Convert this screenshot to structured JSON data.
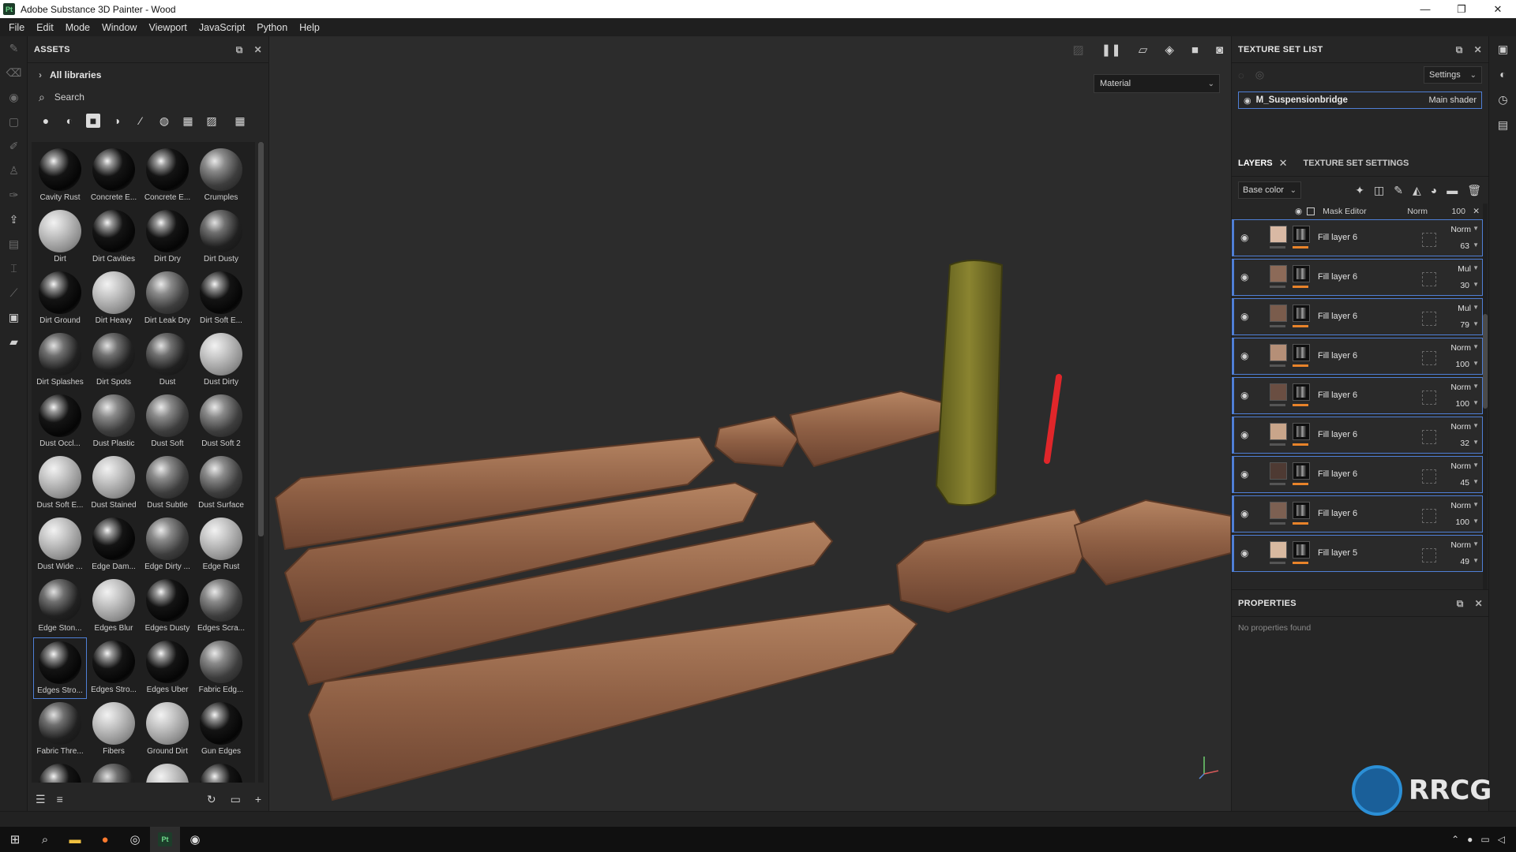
{
  "window": {
    "app_icon": "Pt",
    "title": "Adobe Substance 3D Painter - Wood",
    "minimize": "—",
    "maximize": "❐",
    "close": "✕"
  },
  "menu": [
    "File",
    "Edit",
    "Mode",
    "Window",
    "Viewport",
    "JavaScript",
    "Python",
    "Help"
  ],
  "assets": {
    "header": "ASSETS",
    "libraries": "All libraries",
    "search_placeholder": "Search",
    "items": [
      {
        "label": "Cavity Rust",
        "style": "dark"
      },
      {
        "label": "Concrete E...",
        "style": "dark"
      },
      {
        "label": "Concrete E...",
        "style": "dark"
      },
      {
        "label": "Crumples",
        "style": "mid"
      },
      {
        "label": "Dirt",
        "style": "light"
      },
      {
        "label": "Dirt Cavities",
        "style": "dark"
      },
      {
        "label": "Dirt Dry",
        "style": "dark"
      },
      {
        "label": "Dirt Dusty",
        "style": "noise"
      },
      {
        "label": "Dirt Ground",
        "style": "dark"
      },
      {
        "label": "Dirt Heavy",
        "style": "light"
      },
      {
        "label": "Dirt Leak Dry",
        "style": "mid"
      },
      {
        "label": "Dirt Soft E...",
        "style": "dark"
      },
      {
        "label": "Dirt Splashes",
        "style": "noise"
      },
      {
        "label": "Dirt Spots",
        "style": "noise"
      },
      {
        "label": "Dust",
        "style": "noise"
      },
      {
        "label": "Dust Dirty",
        "style": "light"
      },
      {
        "label": "Dust Occl...",
        "style": "dark"
      },
      {
        "label": "Dust Plastic",
        "style": "mid"
      },
      {
        "label": "Dust Soft",
        "style": "mid"
      },
      {
        "label": "Dust Soft 2",
        "style": "mid"
      },
      {
        "label": "Dust Soft E...",
        "style": "light"
      },
      {
        "label": "Dust Stained",
        "style": "light"
      },
      {
        "label": "Dust Subtle",
        "style": "mid"
      },
      {
        "label": "Dust Surface",
        "style": "mid"
      },
      {
        "label": "Dust Wide ...",
        "style": "light"
      },
      {
        "label": "Edge Dam...",
        "style": "dark"
      },
      {
        "label": "Edge Dirty ...",
        "style": "mid"
      },
      {
        "label": "Edge Rust",
        "style": "light"
      },
      {
        "label": "Edge Ston...",
        "style": "noise"
      },
      {
        "label": "Edges Blur",
        "style": "light"
      },
      {
        "label": "Edges Dusty",
        "style": "dark"
      },
      {
        "label": "Edges Scra...",
        "style": "mid"
      },
      {
        "label": "Edges Stro...",
        "style": "dark"
      },
      {
        "label": "Edges Stro...",
        "style": "dark"
      },
      {
        "label": "Edges Uber",
        "style": "dark"
      },
      {
        "label": "Fabric Edg...",
        "style": "mid"
      },
      {
        "label": "Fabric Thre...",
        "style": "noise"
      },
      {
        "label": "Fibers",
        "style": "light"
      },
      {
        "label": "Ground Dirt",
        "style": "light"
      },
      {
        "label": "Gun Edges",
        "style": "dark"
      },
      {
        "label": "",
        "style": "dark"
      },
      {
        "label": "",
        "style": "noise"
      },
      {
        "label": "",
        "style": "light"
      },
      {
        "label": "",
        "style": "dark"
      }
    ]
  },
  "viewport": {
    "mode_select": "Material"
  },
  "texture_set_list": {
    "header": "TEXTURE SET LIST",
    "settings_label": "Settings",
    "set_name": "M_Suspensionbridge",
    "shader": "Main shader"
  },
  "layers": {
    "tab_layers": "LAYERS",
    "tab_settings": "TEXTURE SET SETTINGS",
    "channel": "Base color",
    "mask_row": {
      "name": "Mask Editor",
      "blend": "Norm",
      "opacity": "100"
    },
    "rows": [
      {
        "name": "Fill layer 6",
        "blend": "Norm",
        "opacity": "63",
        "swatch": "#d9b9a4"
      },
      {
        "name": "Fill layer 6",
        "blend": "Mul",
        "opacity": "30",
        "swatch": "#8c6a58"
      },
      {
        "name": "Fill layer 6",
        "blend": "Mul",
        "opacity": "79",
        "swatch": "#7a5c4c"
      },
      {
        "name": "Fill layer 6",
        "blend": "Norm",
        "opacity": "100",
        "swatch": "#b58f77"
      },
      {
        "name": "Fill layer 6",
        "blend": "Norm",
        "opacity": "100",
        "swatch": "#6a4e42"
      },
      {
        "name": "Fill layer 6",
        "blend": "Norm",
        "opacity": "32",
        "swatch": "#c9a58a"
      },
      {
        "name": "Fill layer 6",
        "blend": "Norm",
        "opacity": "45",
        "swatch": "#4e3a33"
      },
      {
        "name": "Fill layer 6",
        "blend": "Norm",
        "opacity": "100",
        "swatch": "#7c6052"
      },
      {
        "name": "Fill layer 5",
        "blend": "Norm",
        "opacity": "49",
        "swatch": "#d8b9a0"
      }
    ]
  },
  "properties": {
    "header": "PROPERTIES",
    "empty_text": "No properties found"
  },
  "colors": {
    "selection": "#4f7fd6",
    "mask_bar": "#e8832a",
    "wood": "#8a5a3f",
    "pole": "#7a7a2a",
    "rope": "#e0262a"
  },
  "watermark": {
    "text": "RRCG"
  }
}
